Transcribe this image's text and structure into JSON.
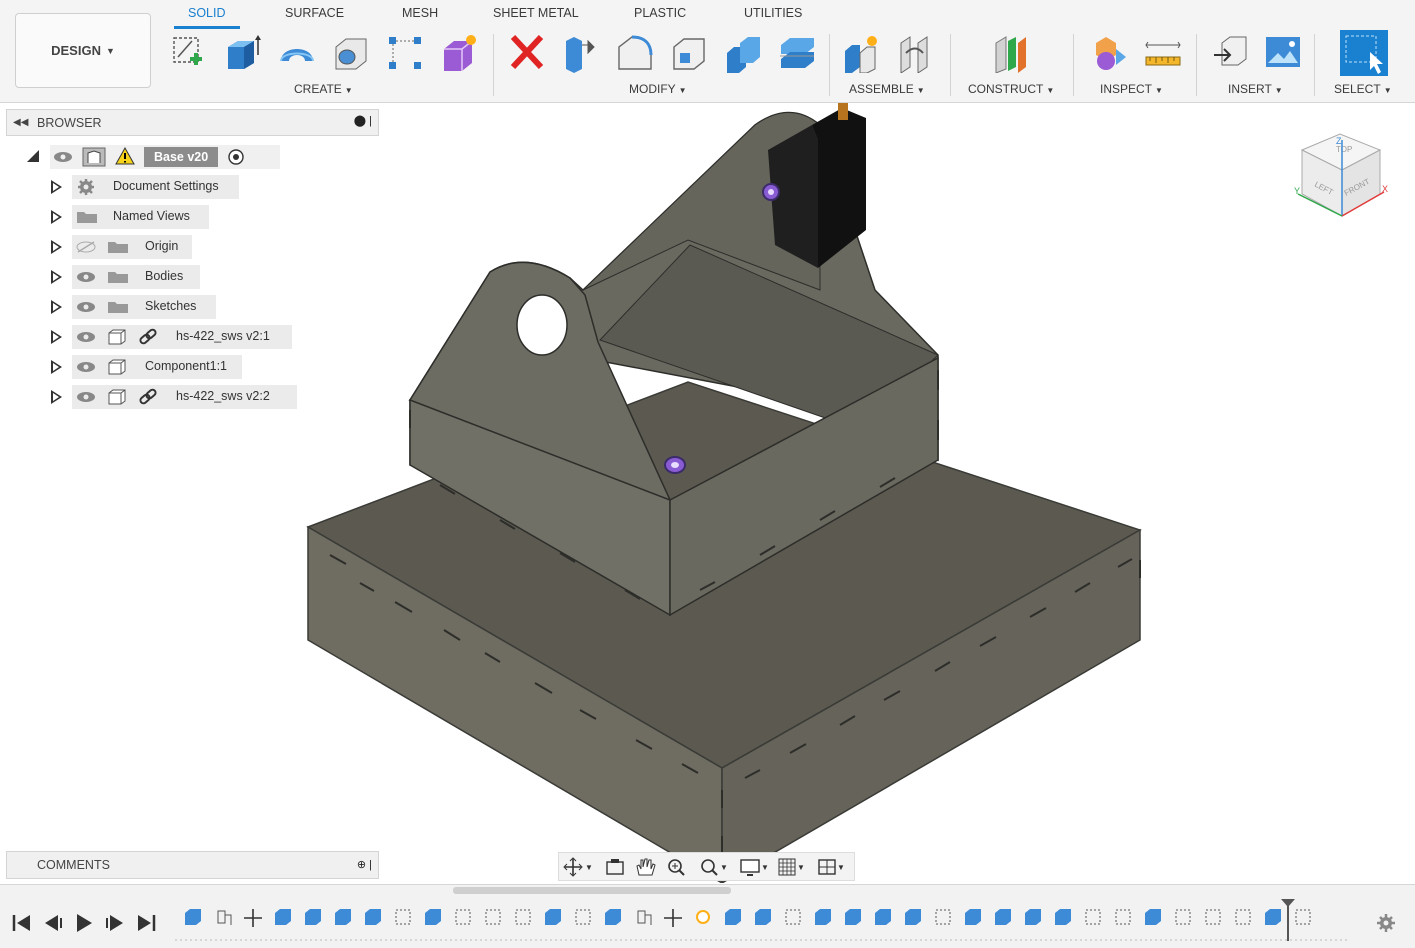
{
  "app": {
    "workspace_button": "DESIGN",
    "tabs": [
      "SOLID",
      "SURFACE",
      "MESH",
      "SHEET METAL",
      "PLASTIC",
      "UTILITIES"
    ],
    "active_tab": "SOLID",
    "groups": {
      "create": "CREATE",
      "modify": "MODIFY",
      "assemble": "ASSEMBLE",
      "construct": "CONSTRUCT",
      "inspect": "INSPECT",
      "insert": "INSERT",
      "select": "SELECT"
    },
    "accent_color": "#1a80d0"
  },
  "browser": {
    "title": "BROWSER",
    "root": {
      "label": "Base v20"
    },
    "items": [
      {
        "label": "Document Settings",
        "icon": "gear-icon"
      },
      {
        "label": "Named Views",
        "icon": "folder-icon"
      },
      {
        "label": "Origin",
        "icon": "folder-icon",
        "visibility": "hidden"
      },
      {
        "label": "Bodies",
        "icon": "folder-icon",
        "visibility": "visible"
      },
      {
        "label": "Sketches",
        "icon": "folder-icon",
        "visibility": "visible"
      },
      {
        "label": "hs-422_sws v2:1",
        "icon": "component-icon",
        "linked": true,
        "visibility": "visible"
      },
      {
        "label": "Component1:1",
        "icon": "component-icon",
        "linked": false,
        "visibility": "visible"
      },
      {
        "label": "hs-422_sws v2:2",
        "icon": "component-icon",
        "linked": true,
        "visibility": "visible"
      }
    ]
  },
  "comments": {
    "title": "COMMENTS"
  },
  "viewcube": {
    "top": "TOP",
    "left": "LEFT",
    "front": "FRONT",
    "axis_x": "X",
    "axis_y": "Y",
    "axis_z": "Z"
  }
}
